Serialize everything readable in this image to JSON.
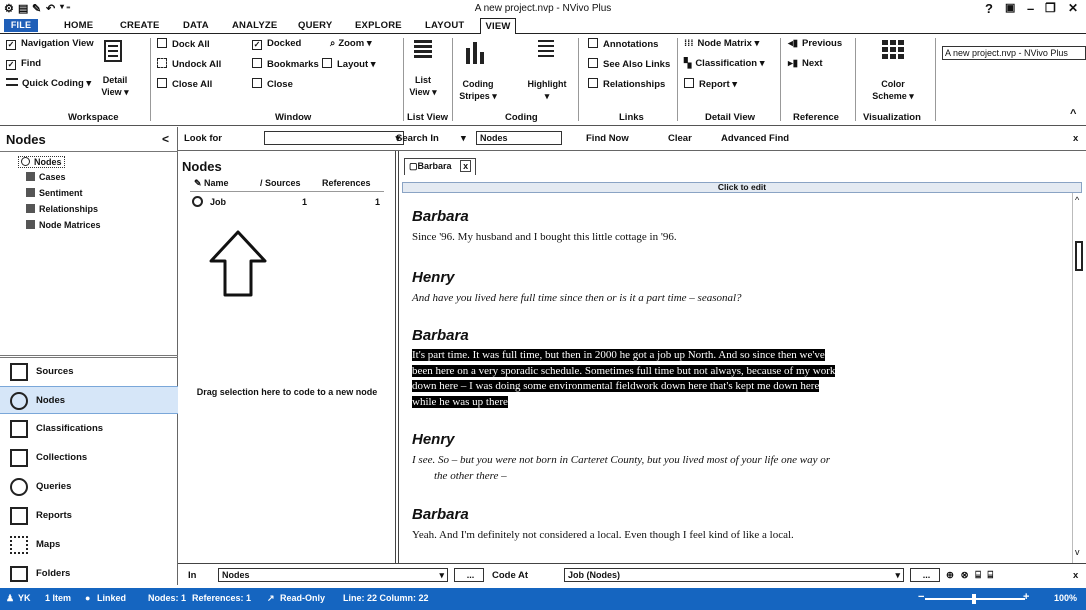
{
  "window": {
    "title": "A new project.nvp - NVivo Plus",
    "help": "?",
    "minimize": "–",
    "restore": "❐",
    "close": "✕"
  },
  "quick_access": {
    "icons": [
      "nvivo-icon",
      "save-icon",
      "edit-icon",
      "undo-icon"
    ]
  },
  "tabs": {
    "file": "FILE",
    "home": "HOME",
    "create": "CREATE",
    "data": "DATA",
    "analyze": "ANALYZE",
    "query": "QUERY",
    "explore": "EXPLORE",
    "layout": "LAYOUT",
    "view": "VIEW"
  },
  "ribbon": {
    "workspace": {
      "navigation_view": "Navigation View",
      "find": "Find",
      "quick_coding": "Quick Coding ▾",
      "detail_view": "Detail",
      "detail_view2": "View ▾",
      "group": "Workspace"
    },
    "window": {
      "dock_all": "Dock All",
      "undock_all": "Undock All",
      "close_all": "Close All",
      "docked": "Docked",
      "bookmarks": "Bookmarks",
      "close": "Close",
      "zoom": "Zoom ▾",
      "layout": "Layout ▾",
      "group": "Window"
    },
    "listview": {
      "list": "List",
      "view": "View ▾",
      "group": "List View"
    },
    "coding": {
      "coding": "Coding",
      "stripes": "Stripes ▾",
      "highlight": "Highlight",
      "highlight_arrow": "▾",
      "group": "Coding"
    },
    "links": {
      "annotations": "Annotations",
      "see_also": "See Also Links",
      "relationships": "Relationships",
      "group": "Links"
    },
    "detailview": {
      "node_matrix": "Node Matrix ▾",
      "classification": "Classification ▾",
      "report": "Report ▾",
      "group": "Detail View"
    },
    "reference": {
      "previous": "Previous",
      "next": "Next",
      "group": "Reference"
    },
    "visualization": {
      "color": "Color",
      "scheme": "Scheme ▾",
      "group": "Visualization"
    },
    "field_value": "A new project.nvp - NVivo Plus",
    "collapse": "^"
  },
  "nav": {
    "title": "Nodes",
    "back": "<",
    "tree": [
      "Nodes",
      "Cases",
      "Sentiment",
      "Relationships",
      "Node Matrices"
    ],
    "buttons": [
      "Sources",
      "Nodes",
      "Classifications",
      "Collections",
      "Queries",
      "Reports",
      "Maps",
      "Folders"
    ]
  },
  "findbar": {
    "look_for": "Look for",
    "search_in": "Search In",
    "search_in_value": "Nodes",
    "find_now": "Find Now",
    "clear": "Clear",
    "advanced_find": "Advanced Find",
    "close": "x"
  },
  "list": {
    "title": "Nodes",
    "columns": [
      "Name",
      "Sources",
      "References"
    ],
    "rows": [
      {
        "name": "Job",
        "sources": "1",
        "references": "1"
      }
    ],
    "drop_hint": "Drag selection here to code to a new node"
  },
  "detail": {
    "tab_label": "Barbara",
    "tab_close": "x",
    "click_to_edit": "Click to edit",
    "blocks": [
      {
        "speaker": "Barbara",
        "text": "Since '96. My husband and I bought this little cottage in '96.",
        "italic": false,
        "highlight": false
      },
      {
        "speaker": "Henry",
        "text": "And have you lived here full time since then or is it a part time – seasonal?",
        "italic": true,
        "highlight": false
      },
      {
        "speaker": "Barbara",
        "lines": [
          "It's part time. It was full time, but then in 2000 he got a job up North. And so since then we've",
          "been here on a very sporadic schedule. Sometimes full time but not always, because of my work",
          "down here – I was doing some environmental fieldwork down here that's kept me down here",
          "while he was up there"
        ],
        "highlight": true
      },
      {
        "speaker": "Henry",
        "lines": [
          "I see. So – but you were not born in Carteret County, but you lived most of your life one way or",
          "the other there –"
        ],
        "italic": true,
        "highlight": false
      },
      {
        "speaker": "Barbara",
        "text": "Yeah. And I'm definitely not considered a local. Even though I feel kind of like a local.",
        "italic": false,
        "highlight": false
      }
    ]
  },
  "codebar": {
    "in": "In",
    "in_value": "Nodes",
    "code_at": "Code At",
    "code_at_value": "Job (Nodes)",
    "ellipsis": "...",
    "close": "x"
  },
  "status": {
    "user": "YK",
    "items": "1 Item",
    "linked": "Linked",
    "nodes": "Nodes: 1",
    "references": "References: 1",
    "readonly": "Read-Only",
    "line": "Line: 22 Column: 22",
    "zoom": "100%"
  },
  "colors": {
    "accent": "#1565c0",
    "file_tab": "#1f5fb8",
    "highlight": "#000000"
  }
}
